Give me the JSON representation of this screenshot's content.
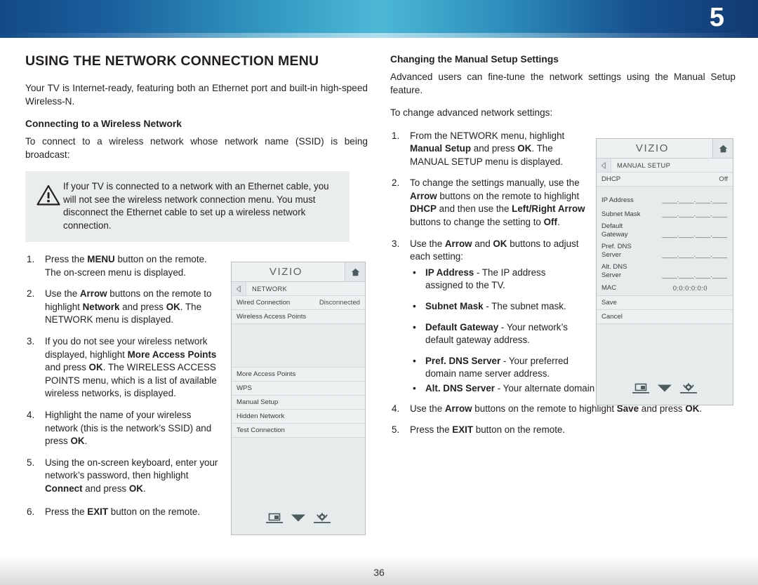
{
  "header": {
    "chapter_number": "5"
  },
  "left_column": {
    "section_title": "USING THE NETWORK CONNECTION MENU",
    "intro": "Your TV is Internet-ready, featuring both an Ethernet port and built-in high-speed Wireless-N.",
    "sub_title": "Connecting to a Wireless Network",
    "sub_intro": "To connect to a wireless network whose network name (SSID) is being broadcast:",
    "warning": {
      "icon": "warning-triangle-icon",
      "text": "If your TV is connected to a network with an Ethernet cable, you will not see the wireless network connection menu. You must disconnect the Ethernet cable to set up a wireless network connection."
    },
    "steps": [
      {
        "num": "1.",
        "html": "Press the <b>MENU</b> button on the remote. The on-screen menu is displayed."
      },
      {
        "num": "2.",
        "html": "Use the <b>Arrow</b> buttons on the remote to highlight <b>Network</b> and press <b>OK</b>. The NETWORK menu is displayed."
      },
      {
        "num": "3.",
        "html": "If you do not see your wireless network displayed, highlight <b>More Access Points</b> and press <b>OK</b>. The WIRELESS ACCESS POINTS menu, which is a list of available wireless networks, is displayed."
      },
      {
        "num": "4.",
        "html": "Highlight the name of your wireless network (this is the network’s SSID) and press <b>OK</b>."
      },
      {
        "num": "5.",
        "html": "Using the on-screen keyboard, enter your network’s password, then highlight <b>Connect</b> and press <b>OK</b>."
      }
    ],
    "final_step": {
      "num": "6.",
      "html": "Press the <b>EXIT</b> button on the remote."
    }
  },
  "right_column": {
    "sub_title": "Changing the Manual Setup Settings",
    "intro": "Advanced users can fine-tune the network settings using the Manual Setup feature.",
    "lead_in": "To change advanced network settings:",
    "steps": [
      {
        "num": "1.",
        "html": "From the NETWORK menu, highlight <b>Manual Setup</b> and press <b>OK</b>. The MANUAL SETUP menu is displayed."
      },
      {
        "num": "2.",
        "html": "To change the settings manually, use the <b>Arrow</b> buttons on the remote to highlight <b>DHCP</b> and then use the <b>Left/Right Arrow</b> buttons to change the setting to <b>Off</b>."
      },
      {
        "num": "3.",
        "html": "Use the <b>Arrow</b> and <b>OK</b> buttons to adjust each setting:"
      }
    ],
    "bullets": [
      {
        "html": "<b>IP Address</b> - The IP address assigned to the TV."
      },
      {
        "html": "<b>Subnet Mask</b> - The subnet mask."
      },
      {
        "html": "<b>Default Gateway</b> - Your network’s default gateway address."
      },
      {
        "html": "<b>Pref. DNS Server</b> - Your preferred domain name server address."
      },
      {
        "html": "<b>Alt. DNS Server</b> - Your alternate domain name server address."
      }
    ],
    "steps_after": [
      {
        "num": "4.",
        "html": "Use the <b>Arrow</b> buttons on the remote to highlight <b>Save</b> and press <b>OK</b>."
      },
      {
        "num": "5.",
        "html": "Press the <b>EXIT</b> button on the remote."
      }
    ]
  },
  "network_menu": {
    "brand": "VIZIO",
    "home_icon": "home-icon",
    "back_icon": "back-arrow-icon",
    "title": "NETWORK",
    "rows": [
      {
        "label": "Wired Connection",
        "value": "Disconnected"
      },
      {
        "label": "Wireless Access Points",
        "value": ""
      }
    ],
    "actions": [
      "More Access Points",
      "WPS",
      "Manual Setup",
      "Hidden Network",
      "Test Connection"
    ],
    "footer_icons": [
      "tv-picture-icon",
      "chevron-down-icon",
      "gear-icon"
    ]
  },
  "manual_setup_menu": {
    "brand": "VIZIO",
    "home_icon": "home-icon",
    "back_icon": "back-arrow-icon",
    "title": "MANUAL SETUP",
    "dhcp": {
      "label": "DHCP",
      "value": "Off"
    },
    "fields": [
      {
        "label": "IP Address",
        "value": "____.____.____.____"
      },
      {
        "label": "Subnet Mask",
        "value": "____.____.____.____"
      },
      {
        "label": "Default Gateway",
        "value": "____.____.____.____"
      },
      {
        "label": "Pref. DNS Server",
        "value": "____.____.____.____"
      },
      {
        "label": "Alt. DNS Server",
        "value": "____.____.____.____"
      },
      {
        "label": "MAC",
        "value": "0:0:0:0:0:0"
      }
    ],
    "buttons": [
      "Save",
      "Cancel"
    ],
    "footer_icons": [
      "tv-picture-icon",
      "chevron-down-icon",
      "gear-icon"
    ]
  },
  "footer": {
    "page_number": "36"
  },
  "colors": {
    "header_left": "#134a87",
    "header_center": "#4cb8d6",
    "header_right": "#123a72",
    "warning_bg": "#e9edee",
    "menu_bg": "#e6ebec"
  }
}
